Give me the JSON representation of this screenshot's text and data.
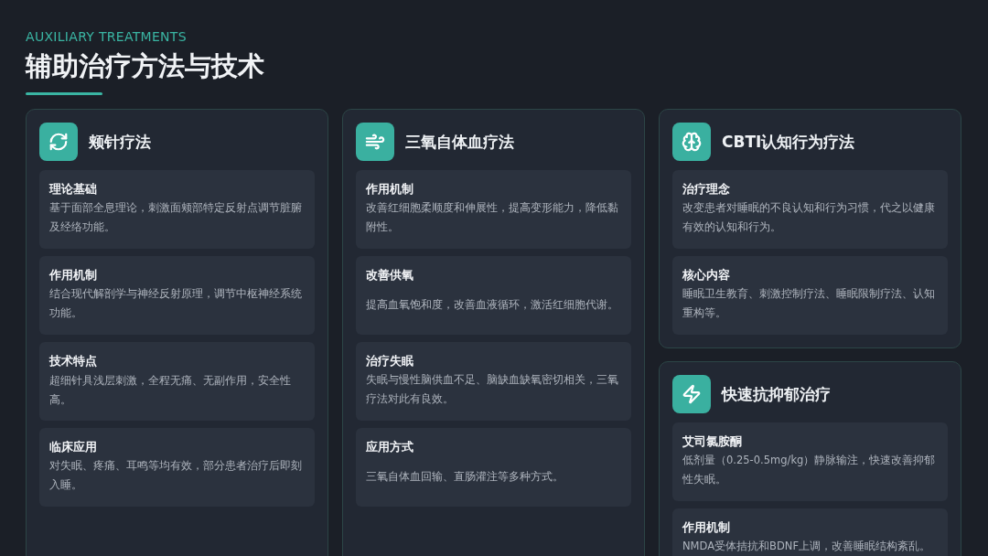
{
  "header": {
    "eyebrow": "AUXILIARY TREATMENTS",
    "title": "辅助治疗方法与技术"
  },
  "columns": [
    {
      "cards": [
        {
          "title": "颊针疗法",
          "sections": [
            {
              "heading": "理论基础",
              "text": "基于面部全息理论，刺激面颊部特定反射点调节脏腑及经络功能。"
            },
            {
              "heading": "作用机制",
              "text": "结合现代解剖学与神经反射原理，调节中枢神经系统功能。"
            },
            {
              "heading": "技术特点",
              "text": "超细针具浅层刺激，全程无痛、无副作用，安全性高。"
            },
            {
              "heading": "临床应用",
              "text": "对失眠、疼痛、耳鸣等均有效，部分患者治疗后即刻入睡。"
            }
          ]
        }
      ]
    },
    {
      "cards": [
        {
          "title": "三氧自体血疗法",
          "sections": [
            {
              "heading": "作用机制",
              "text": "改善红细胞柔顺度和伸展性，提高变形能力，降低黏附性。"
            },
            {
              "heading": "改善供氧",
              "text": "提高血氧饱和度，改善血液循环，激活红细胞代谢。"
            },
            {
              "heading": "治疗失眠",
              "text": "失眠与慢性脑供血不足、脑缺血缺氧密切相关，三氧疗法对此有良效。"
            },
            {
              "heading": "应用方式",
              "text": "三氧自体血回输、直肠灌注等多种方式。"
            }
          ]
        }
      ]
    },
    {
      "cards": [
        {
          "title": "CBTI认知行为疗法",
          "sections": [
            {
              "heading": "治疗理念",
              "text": "改变患者对睡眠的不良认知和行为习惯，代之以健康有效的认知和行为。"
            },
            {
              "heading": "核心内容",
              "text": "睡眠卫生教育、刺激控制疗法、睡眠限制疗法、认知重构等。"
            }
          ]
        },
        {
          "title": "快速抗抑郁治疗",
          "sections": [
            {
              "heading": "艾司氯胺酮",
              "text": "低剂量（0.25-0.5mg/kg）静脉输注，快速改善抑郁性失眠。"
            },
            {
              "heading": "作用机制",
              "text": "NMDA受体拮抗和BDNF上调，改善睡眠结构紊乱。"
            }
          ]
        }
      ]
    }
  ]
}
